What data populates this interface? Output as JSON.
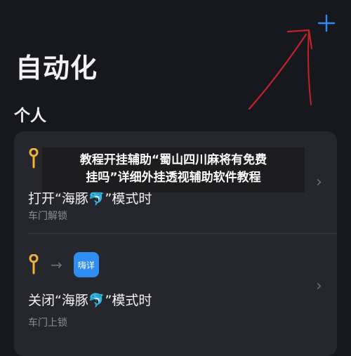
{
  "header": {
    "title": "自动化",
    "add_symbol": "+"
  },
  "section": {
    "title": "个人"
  },
  "automations": [
    {
      "trigger_icon": "key-icon",
      "app_label": "",
      "title": "打开“海豚🐬”模式时",
      "subtitle": "车门解锁"
    },
    {
      "trigger_icon": "key-icon",
      "app_label": "嗨详",
      "title": "关闭“海豚🐬”模式时",
      "subtitle": "车门上锁"
    }
  ],
  "glyphs": {
    "arrow": "→",
    "chevron": "›"
  },
  "overlay": {
    "line1": "教程开挂辅助“蜀山四川麻将有免费",
    "line2": "挂吗”详细外挂透视辅助软件教程"
  },
  "colors": {
    "background": "#17181d",
    "card": "#26272d",
    "accent": "#2f8cf3",
    "key": "#f2b233",
    "annotation": "#c4202f"
  }
}
